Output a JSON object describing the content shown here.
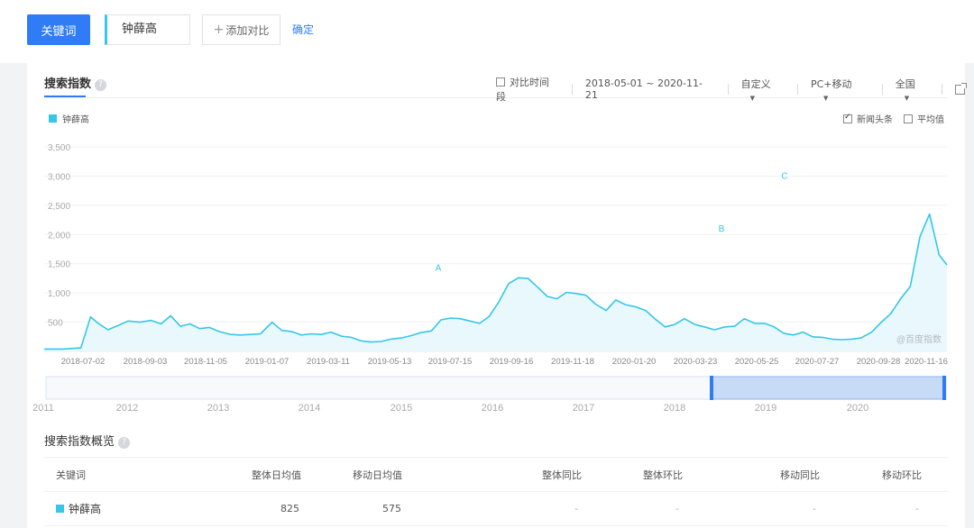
{
  "top": {
    "keyword_button": "关键词",
    "keyword_value": "钟薛高",
    "add_compare": "添加对比",
    "confirm": "确定"
  },
  "panel": {
    "tab_title": "搜索指数",
    "help": "?",
    "compare_period": "对比时间段",
    "date_range": "2018-05-01 ~ 2020-11-21",
    "custom": "自定义",
    "device": "PC+移动",
    "region": "全国",
    "legend_name": "钟薛高",
    "news_headline": "新闻头条",
    "average": "平均值",
    "watermark": "@百度指数"
  },
  "chart_data": {
    "type": "line",
    "series": [
      {
        "name": "钟薛高",
        "color": "#36c6e8",
        "points": [
          [
            "2018-05-01",
            40
          ],
          [
            "2018-05-20",
            40
          ],
          [
            "2018-06-08",
            60
          ],
          [
            "2018-06-18",
            590
          ],
          [
            "2018-06-26",
            480
          ],
          [
            "2018-07-06",
            370
          ],
          [
            "2018-07-16",
            440
          ],
          [
            "2018-07-27",
            520
          ],
          [
            "2018-08-08",
            500
          ],
          [
            "2018-08-20",
            530
          ],
          [
            "2018-08-30",
            470
          ],
          [
            "2018-09-09",
            610
          ],
          [
            "2018-09-19",
            430
          ],
          [
            "2018-09-29",
            470
          ],
          [
            "2018-10-09",
            390
          ],
          [
            "2018-10-19",
            410
          ],
          [
            "2018-10-29",
            340
          ],
          [
            "2018-11-10",
            290
          ],
          [
            "2018-11-20",
            280
          ],
          [
            "2018-12-01",
            290
          ],
          [
            "2018-12-11",
            300
          ],
          [
            "2018-12-23",
            500
          ],
          [
            "2019-01-02",
            360
          ],
          [
            "2019-01-12",
            340
          ],
          [
            "2019-01-22",
            280
          ],
          [
            "2019-02-02",
            300
          ],
          [
            "2019-02-12",
            290
          ],
          [
            "2019-02-22",
            330
          ],
          [
            "2019-03-05",
            260
          ],
          [
            "2019-03-15",
            240
          ],
          [
            "2019-03-25",
            180
          ],
          [
            "2019-04-05",
            160
          ],
          [
            "2019-04-15",
            170
          ],
          [
            "2019-04-25",
            210
          ],
          [
            "2019-05-06",
            230
          ],
          [
            "2019-05-16",
            270
          ],
          [
            "2019-05-26",
            320
          ],
          [
            "2019-06-06",
            350
          ],
          [
            "2019-06-16",
            540
          ],
          [
            "2019-06-26",
            570
          ],
          [
            "2019-07-06",
            560
          ],
          [
            "2019-07-16",
            520
          ],
          [
            "2019-07-26",
            480
          ],
          [
            "2019-08-05",
            600
          ],
          [
            "2019-08-15",
            850
          ],
          [
            "2019-08-25",
            1160
          ],
          [
            "2019-09-04",
            1260
          ],
          [
            "2019-09-14",
            1250
          ],
          [
            "2019-09-24",
            1100
          ],
          [
            "2019-10-04",
            940
          ],
          [
            "2019-10-14",
            900
          ],
          [
            "2019-10-24",
            1010
          ],
          [
            "2019-11-03",
            990
          ],
          [
            "2019-11-13",
            960
          ],
          [
            "2019-11-23",
            810
          ],
          [
            "2019-12-04",
            700
          ],
          [
            "2019-12-14",
            880
          ],
          [
            "2019-12-24",
            800
          ],
          [
            "2020-01-04",
            760
          ],
          [
            "2020-01-14",
            700
          ],
          [
            "2020-01-24",
            550
          ],
          [
            "2020-02-03",
            420
          ],
          [
            "2020-02-13",
            460
          ],
          [
            "2020-02-23",
            560
          ],
          [
            "2020-03-05",
            460
          ],
          [
            "2020-03-15",
            420
          ],
          [
            "2020-03-25",
            370
          ],
          [
            "2020-04-05",
            420
          ],
          [
            "2020-04-15",
            430
          ],
          [
            "2020-04-25",
            560
          ],
          [
            "2020-05-06",
            480
          ],
          [
            "2020-05-16",
            480
          ],
          [
            "2020-05-26",
            420
          ],
          [
            "2020-06-05",
            310
          ],
          [
            "2020-06-15",
            280
          ],
          [
            "2020-06-25",
            330
          ],
          [
            "2020-07-05",
            250
          ],
          [
            "2020-07-15",
            240
          ],
          [
            "2020-07-25",
            210
          ],
          [
            "2020-08-04",
            200
          ],
          [
            "2020-08-14",
            210
          ],
          [
            "2020-08-24",
            230
          ],
          [
            "2020-09-04",
            330
          ],
          [
            "2020-09-14",
            500
          ],
          [
            "2020-09-24",
            650
          ],
          [
            "2020-10-04",
            900
          ],
          [
            "2020-10-14",
            1110
          ],
          [
            "2020-10-24",
            1960
          ],
          [
            "2020-11-03",
            2350
          ],
          [
            "2020-11-13",
            1650
          ],
          [
            "2020-11-21",
            1480
          ]
        ]
      }
    ],
    "ylim": [
      0,
      3500
    ],
    "y_ticks": [
      "500",
      "1,000",
      "1,500",
      "2,000",
      "2,500",
      "3,000",
      "3,500"
    ],
    "x_ticks": [
      "2018-07-02",
      "2018-09-03",
      "2018-11-05",
      "2019-01-07",
      "2019-03-11",
      "2019-05-13",
      "2019-07-15",
      "2019-09-16",
      "2019-11-18",
      "2020-01-20",
      "2020-03-23",
      "2020-05-25",
      "2020-07-27",
      "2020-09-28",
      "2020-11-16"
    ],
    "annotations": [
      "A",
      "B",
      "C"
    ],
    "navigator_years": [
      "2011",
      "2012",
      "2013",
      "2014",
      "2015",
      "2016",
      "2017",
      "2018",
      "2019",
      "2020"
    ],
    "grid": true
  },
  "overview": {
    "title": "搜索指数概览",
    "headers": [
      "关键词",
      "整体日均值",
      "移动日均值",
      "整体同比",
      "整体环比",
      "移动同比",
      "移动环比"
    ],
    "rows": [
      {
        "keyword": "钟薛高",
        "overall_avg": "825",
        "mobile_avg": "575",
        "overall_yoy": "-",
        "overall_mom": "-",
        "mobile_yoy": "-",
        "mobile_mom": "-"
      }
    ]
  }
}
